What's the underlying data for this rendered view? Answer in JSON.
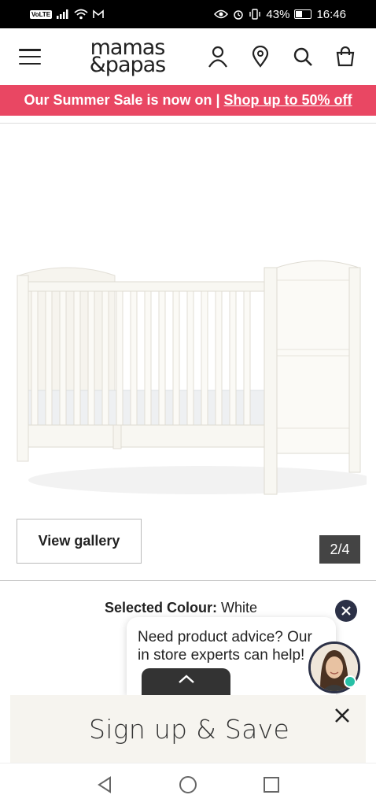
{
  "status_bar": {
    "volte": "VoLTE",
    "battery_percent": "43%",
    "battery_level": 0.43,
    "time": "16:46"
  },
  "header": {
    "logo_line1": "mamas",
    "logo_line2": "&papas",
    "icons": [
      "menu-icon",
      "account-icon",
      "location-pin-icon",
      "search-icon",
      "shopping-bag-icon"
    ]
  },
  "promo": {
    "text": "Our Summer Sale is now on |",
    "link": "Shop up to 50% off",
    "color": "#e94763"
  },
  "gallery": {
    "view_gallery_label": "View gallery",
    "page_counter": "2/4"
  },
  "product": {
    "selected_colour_label": "Selected Colour:",
    "selected_colour_value": "White"
  },
  "chat": {
    "message": "Need product advice? Our in store experts can help!",
    "accent": "#2c3147",
    "online_color": "#27c0a6"
  },
  "signup": {
    "label": "Sign up & Save"
  },
  "navigation": {
    "buttons": [
      "back-icon",
      "home-icon",
      "recents-icon"
    ]
  }
}
